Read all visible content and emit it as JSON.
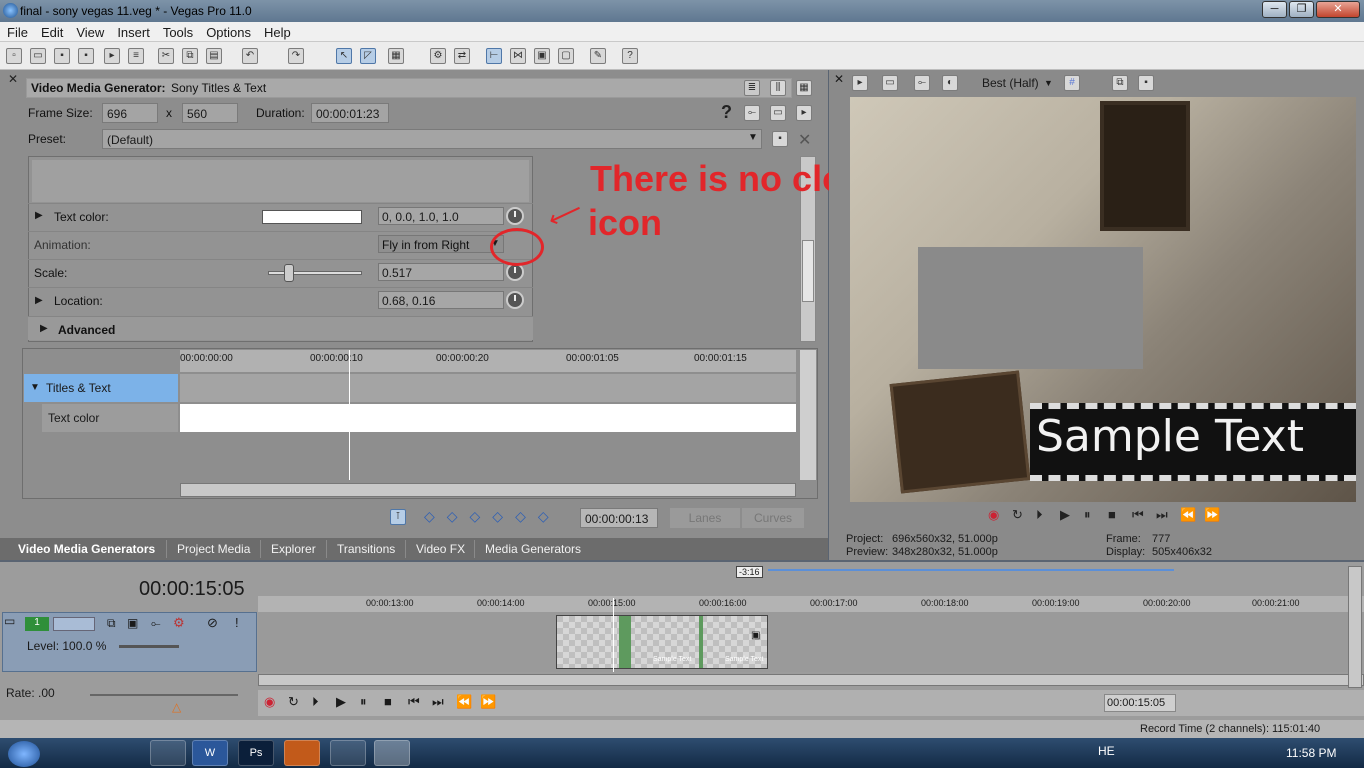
{
  "window": {
    "title": "final - sony vegas 11.veg * - Vegas Pro 11.0"
  },
  "menu": [
    "File",
    "Edit",
    "View",
    "Insert",
    "Tools",
    "Options",
    "Help"
  ],
  "vmg": {
    "header_label": "Video Media Generator:",
    "header_value": "Sony Titles & Text",
    "frame_size_label": "Frame Size:",
    "frame_w": "696",
    "x_label": "x",
    "frame_h": "560",
    "duration_label": "Duration:",
    "duration": "00:00:01:23",
    "help_glyph": "?",
    "preset_label": "Preset:",
    "preset_value": "(Default)"
  },
  "props": {
    "text_color_label": "Text color:",
    "text_color_value": "0, 0.0, 1.0, 1.0",
    "animation_label": "Animation:",
    "animation_value": "Fly in from Right",
    "scale_label": "Scale:",
    "scale_value": "0.517",
    "scale_level": 0.25,
    "location_label": "Location:",
    "location_value": "0.68, 0.16",
    "advanced_label": "Advanced"
  },
  "annotation": {
    "line1": "There is no clock",
    "line2": "icon"
  },
  "keyframes": {
    "ruler": [
      "00:00:00:00",
      "00:00:00:10",
      "00:00:00:20",
      "00:00:01:05",
      "00:00:01:15"
    ],
    "track1": "Titles & Text",
    "track2": "Text color",
    "time": "00:00:00:13",
    "lanes": "Lanes",
    "curves": "Curves"
  },
  "tabs": [
    "Video Media Generators",
    "Project Media",
    "Explorer",
    "Transitions",
    "Video FX",
    "Media Generators"
  ],
  "preview": {
    "quality": "Best (Half)",
    "sample_text": "Sample Text",
    "project_label": "Project:",
    "project_value": "696x560x32, 51.000p",
    "preview_label": "Preview:",
    "preview_value": "348x280x32, 51.000p",
    "frame_label": "Frame:",
    "frame_value": "777",
    "display_label": "Display:",
    "display_value": "505x406x32"
  },
  "timeline": {
    "time": "00:00:15:05",
    "marker": "-3:16",
    "ruler": [
      "00:00:13:00",
      "00:00:14:00",
      "00:00:15:00",
      "00:00:16:00",
      "00:00:17:00",
      "00:00:18:00",
      "00:00:19:00",
      "00:00:20:00",
      "00:00:21:00"
    ],
    "track_num": "1",
    "level": "Level: 100.0 %",
    "rate": "Rate: .00",
    "clip_label1": "Sample Text",
    "clip_label2": "Sample Text",
    "transport_time": "00:00:15:05",
    "record_time": "Record Time (2 channels): 115:01:40"
  },
  "taskbar": {
    "lang": "HE",
    "clock": "11:58 PM",
    "apps": [
      "",
      "W",
      "Ps",
      "",
      "",
      ""
    ]
  }
}
